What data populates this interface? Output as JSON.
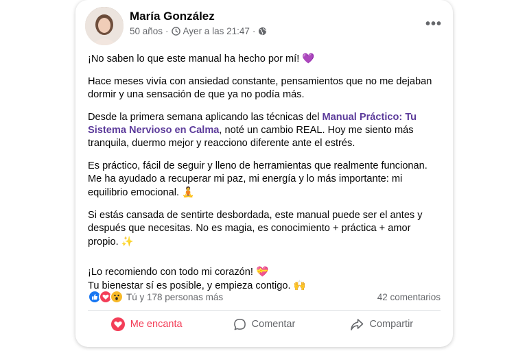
{
  "post": {
    "author": "María González",
    "age": "50 años",
    "separator": "·",
    "time": "Ayer a las 21:47",
    "separator2": "·",
    "paragraphs": {
      "p1_text": "¡No saben lo que este manual ha hecho por mí! ",
      "p1_emoji": "💜",
      "p2": "Hace meses vivía con ansiedad constante, pensamientos que no me dejaban dormir y una sensación de que ya no podía más.",
      "p3_before": "Desde la primera semana aplicando las técnicas del ",
      "p3_highlight": "Manual Práctico: Tu Sistema Nervioso en Calma",
      "p3_after": ", noté un cambio REAL. Hoy me siento más tranquila, duermo mejor y reacciono diferente ante el estrés.",
      "p4_text": "Es práctico, fácil de seguir y lleno de herramientas que realmente funcionan. Me ha ayudado a recuperar mi paz, mi energía y lo más importante: mi equilibrio emocional. ",
      "p4_emoji": "🧘",
      "p5_text": "Si estás cansada de sentirte desbordada, este manual puede ser el antes y después que necesitas. No es magia, es conocimiento + práctica + amor propio. ",
      "p5_emoji": "✨",
      "p6_line1": "¡Lo recomiendo con todo mi corazón! ",
      "p6_emoji1": "💝",
      "p6_line2": "Tu bienestar sí es posible, y empieza contigo. ",
      "p6_emoji2": "🙌"
    },
    "reactions_text": "Tú y 178 personas más",
    "comments": "42 comentarios",
    "actions": {
      "love": "Me encanta",
      "comment": "Comentar",
      "share": "Compartir"
    },
    "colors": {
      "highlight": "#5b3a9a",
      "love": "#f33e58",
      "like": "#1877f2",
      "wow": "#f7b928"
    }
  }
}
